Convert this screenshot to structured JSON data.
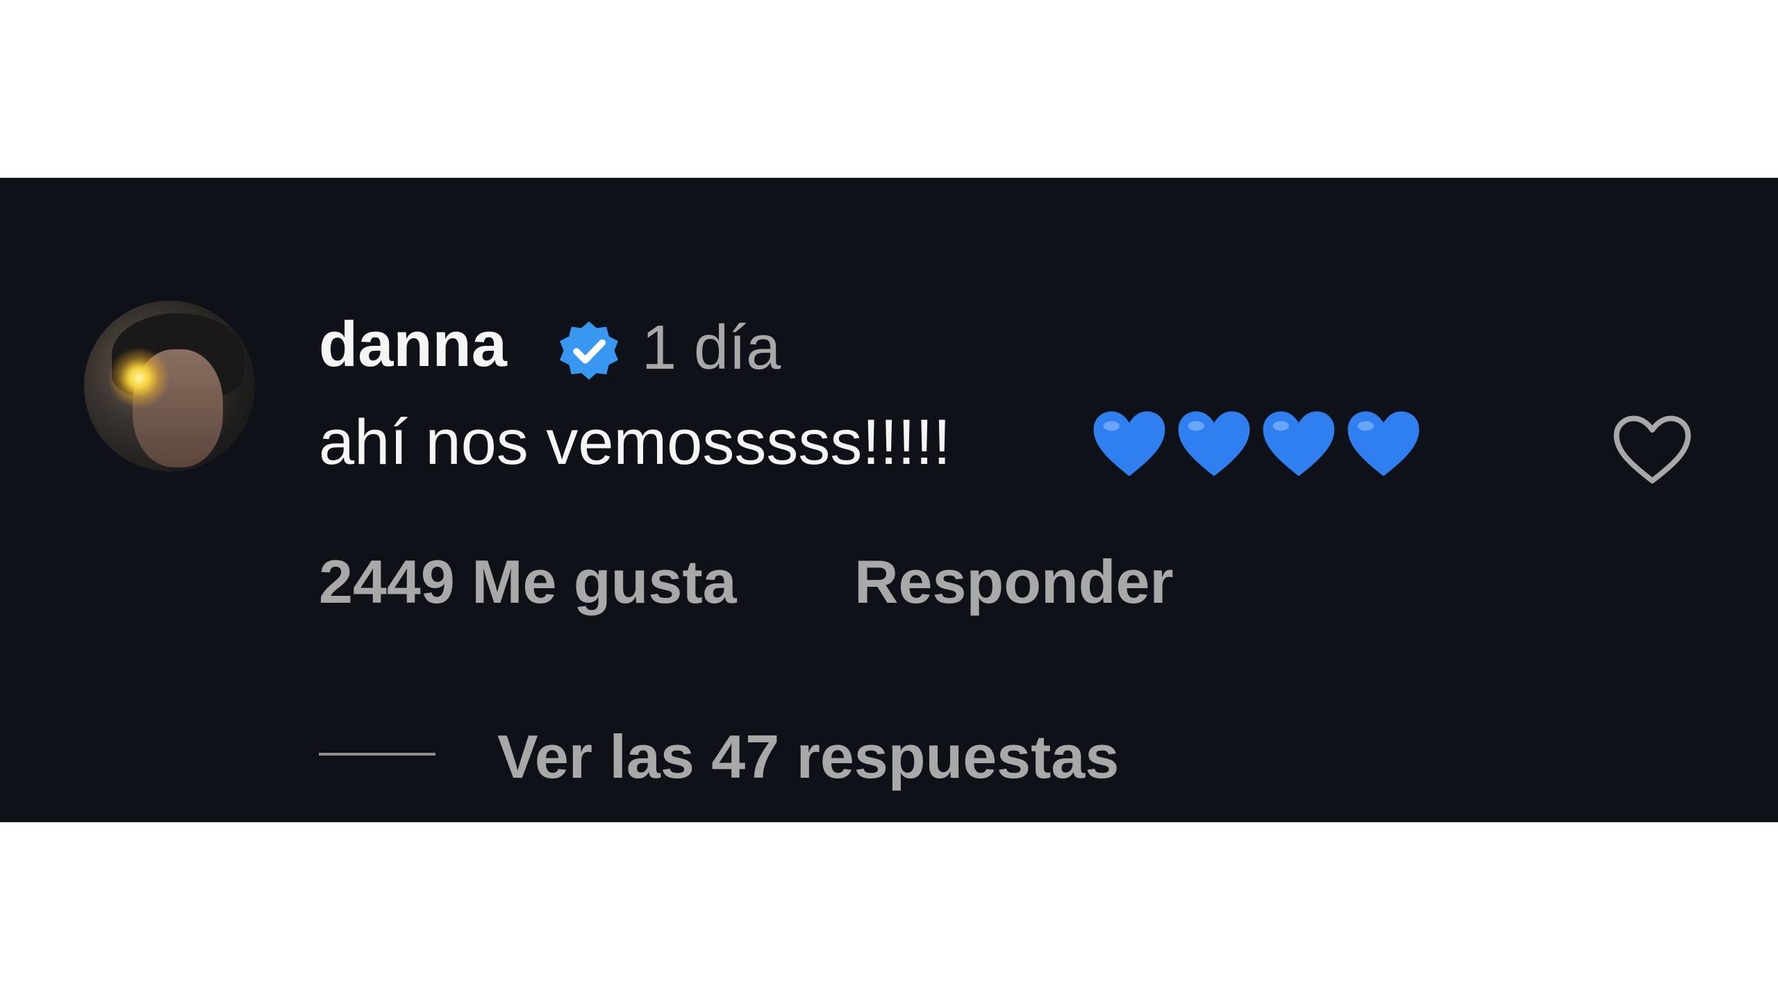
{
  "comment": {
    "username": "danna",
    "time_ago": "1 día",
    "text": "ahí nos vemosssss!!!!!",
    "emoji": [
      "blue-heart",
      "blue-heart",
      "blue-heart",
      "blue-heart"
    ],
    "likes_label": "2449 Me gusta",
    "reply_label": "Responder",
    "view_replies_label": "Ver las 47 respuestas",
    "verified": true
  },
  "icons": {
    "verified": "verified-badge-icon",
    "like": "heart-outline-icon"
  },
  "colors": {
    "background": "#0e1117",
    "primary_text": "#f5f5f5",
    "secondary_text": "#a8a8a8",
    "verified": "#3897f0",
    "heart_emoji": "#2f7ff0"
  }
}
